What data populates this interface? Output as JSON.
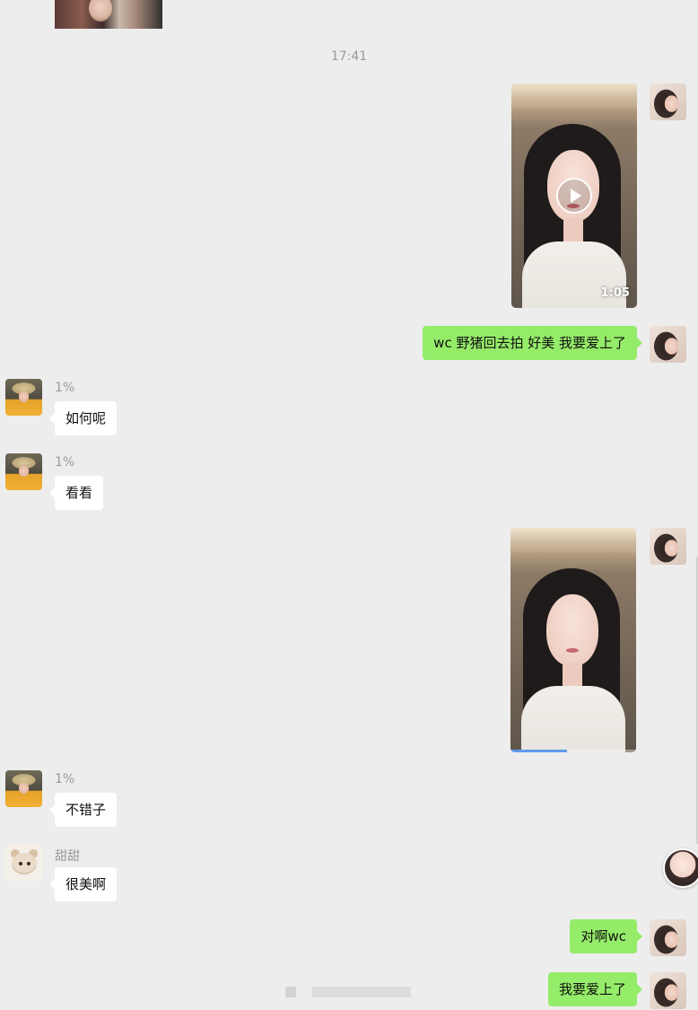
{
  "conversation": {
    "timestamp": "17:41",
    "messages": [
      {
        "type": "image",
        "side": "in",
        "name": "top-photo"
      },
      {
        "type": "video",
        "side": "out",
        "duration": "1:05",
        "has_play_button": true
      },
      {
        "type": "text",
        "side": "out",
        "text": "wc 野猪回去拍 好美 我要爱上了"
      },
      {
        "type": "text",
        "side": "in",
        "sender": "1%",
        "text": "如何呢"
      },
      {
        "type": "text",
        "side": "in",
        "sender": "1%",
        "text": "看看"
      },
      {
        "type": "video",
        "side": "out",
        "progress": 0.45
      },
      {
        "type": "text",
        "side": "in",
        "sender": "1%",
        "text": "不错子"
      },
      {
        "type": "text",
        "side": "in",
        "sender": "甜甜",
        "text": "很美啊"
      },
      {
        "type": "text",
        "side": "out",
        "text": "对啊wc"
      },
      {
        "type": "text",
        "side": "out",
        "text": "我要爱上了"
      }
    ]
  },
  "colors": {
    "background": "#ededed",
    "bubble_out": "#95ec69",
    "bubble_in": "#ffffff",
    "meta_text": "#9a9a9a"
  },
  "icons": [
    "play-icon",
    "avatar-me",
    "avatar-1pct",
    "avatar-tiantian"
  ]
}
